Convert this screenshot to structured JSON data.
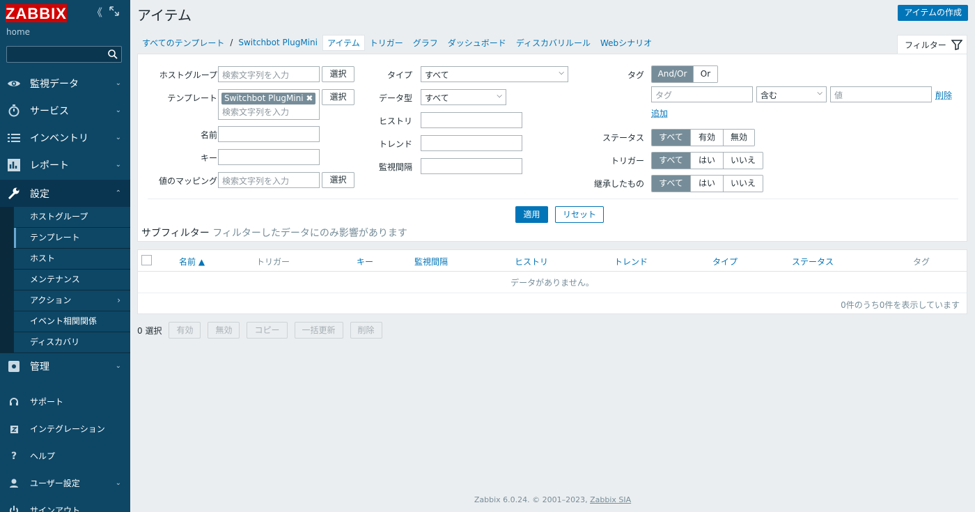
{
  "sidebar": {
    "logo": "ZABBIX",
    "host": "home",
    "search_placeholder": "",
    "menu": {
      "monitoring": "監視データ",
      "services": "サービス",
      "inventory": "インベントリ",
      "reports": "レポート",
      "configuration": "設定",
      "administration": "管理",
      "support": "サポート",
      "integrations": "インテグレーション",
      "help": "ヘルプ",
      "user_settings": "ユーザー設定",
      "sign_out": "サインアウト"
    },
    "config_sub": [
      "ホストグループ",
      "テンプレート",
      "ホスト",
      "メンテナンス",
      "アクション",
      "イベント相関関係",
      "ディスカバリ"
    ]
  },
  "header": {
    "title": "アイテム",
    "create_button": "アイテムの作成"
  },
  "breadcrumbs": {
    "all_templates": "すべてのテンプレート",
    "separator": "/",
    "template": "Switchbot PlugMini",
    "items": "アイテム",
    "triggers": "トリガー",
    "graphs": "グラフ",
    "dashboards": "ダッシュボード",
    "discovery": "ディスカバリルール",
    "web": "Webシナリオ"
  },
  "filter": {
    "tab_label": "フィルター",
    "host_group_label": "ホストグループ",
    "search_placeholder": "検索文字列を入力",
    "select_button": "選択",
    "template_label": "テンプレート",
    "template_chip": "Switchbot PlugMini",
    "name_label": "名前",
    "key_label": "キー",
    "valuemap_label": "値のマッピング",
    "type_label": "タイプ",
    "type_value": "すべて",
    "datatype_label": "データ型",
    "datatype_value": "すべて",
    "history_label": "ヒストリ",
    "trend_label": "トレンド",
    "interval_label": "監視間隔",
    "tags_label": "タグ",
    "tags_andor": "And/Or",
    "tags_or": "Or",
    "tag_placeholder": "タグ",
    "tag_operator": "含む",
    "value_placeholder": "値",
    "remove_link": "削除",
    "add_link": "追加",
    "status_label": "ステータス",
    "status_opts": [
      "すべて",
      "有効",
      "無効"
    ],
    "trigger_label": "トリガー",
    "yesno_opts": [
      "すべて",
      "はい",
      "いいえ"
    ],
    "inherited_label": "継承したもの",
    "apply_button": "適用",
    "reset_button": "リセット"
  },
  "subfilter": {
    "title": "サブフィルター",
    "hint": "フィルターしたデータにのみ影響があります"
  },
  "table": {
    "columns": {
      "name": "名前 ▲",
      "triggers": "トリガー",
      "key": "キー",
      "interval": "監視間隔",
      "history": "ヒストリ",
      "trends": "トレンド",
      "type": "タイプ",
      "status": "ステータス",
      "tags": "タグ"
    },
    "no_data": "データがありません。",
    "paging": "0件のうち0件を表示しています"
  },
  "actions": {
    "selected": "0 選択",
    "enable": "有効",
    "disable": "無効",
    "copy": "コピー",
    "mass_update": "一括更新",
    "delete": "削除"
  },
  "footer": {
    "text": "Zabbix 6.0.24. © 2001–2023,",
    "link": "Zabbix SIA"
  }
}
